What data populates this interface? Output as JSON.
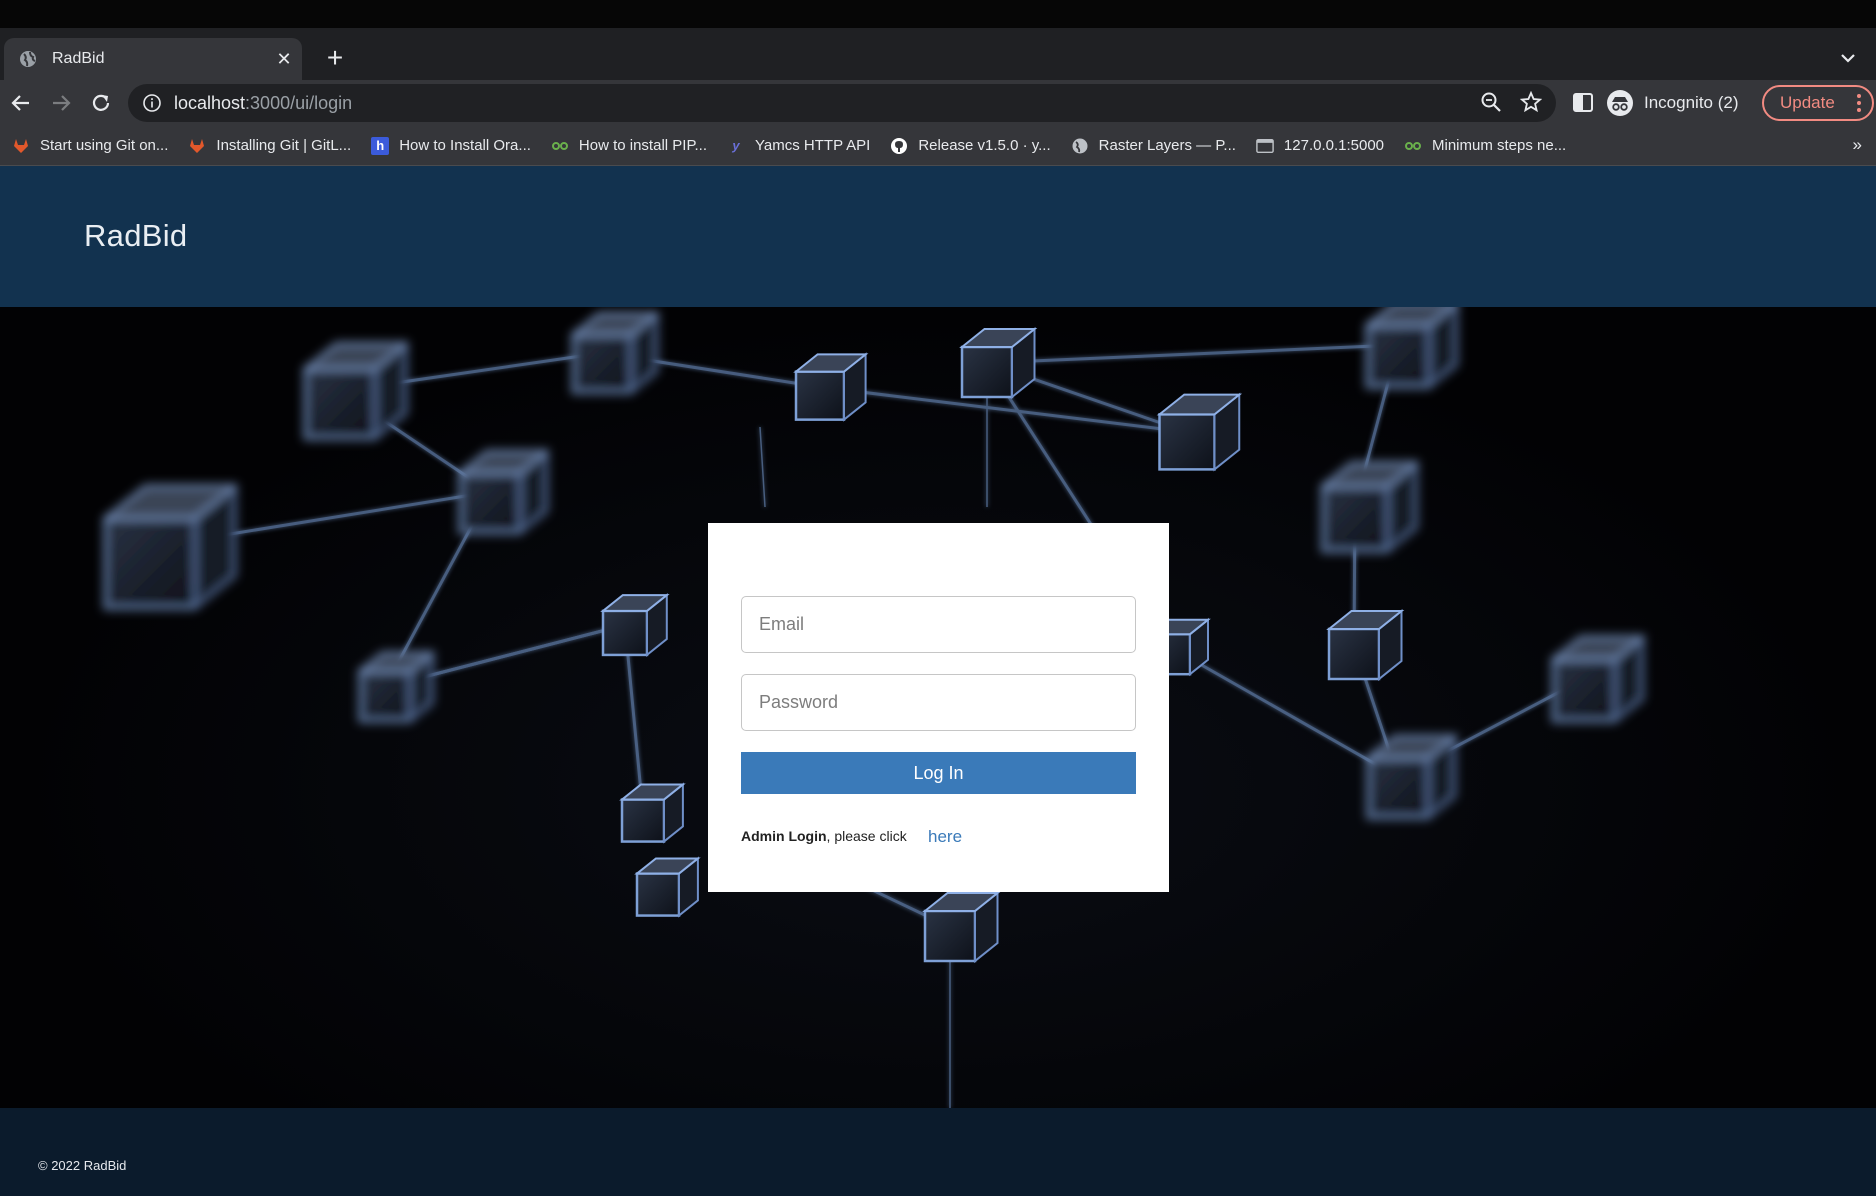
{
  "browser": {
    "tab": {
      "title": "RadBid",
      "favicon": "globe-icon"
    },
    "url": {
      "host": "localhost",
      "path": ":3000/ui/login"
    },
    "profile_label": "Incognito (2)",
    "update_label": "Update",
    "bookmarks": [
      {
        "label": "Start using Git on...",
        "icon": "gitlab-icon",
        "color": "#e2582b"
      },
      {
        "label": "Installing Git | GitL...",
        "icon": "gitlab-icon",
        "color": "#e2582b"
      },
      {
        "label": "How to Install Ora...",
        "icon": "h-icon",
        "color": "#3b5bdb"
      },
      {
        "label": "How to install PIP...",
        "icon": "link-icon",
        "color": "#6ab04c"
      },
      {
        "label": "Yamcs HTTP API",
        "icon": "yamcs-icon",
        "color": "#6a6fd8"
      },
      {
        "label": "Release v1.5.0 · y...",
        "icon": "github-icon",
        "color": "#ffffff"
      },
      {
        "label": "Raster Layers — P...",
        "icon": "globe-icon",
        "color": "#bdc1c6"
      },
      {
        "label": "127.0.0.1:5000",
        "icon": "page-icon",
        "color": "#bdc1c6"
      },
      {
        "label": "Minimum steps ne...",
        "icon": "link-icon",
        "color": "#6ab04c"
      }
    ],
    "bookmarks_more": "»"
  },
  "app": {
    "brand": "RadBid",
    "login": {
      "email_placeholder": "Email",
      "password_placeholder": "Password",
      "submit_label": "Log In",
      "admin_bold": "Admin Login",
      "admin_rest": ", please click",
      "admin_link": "here"
    },
    "footer": "© 2022 RadBid"
  },
  "colors": {
    "header_bg": "#12324f",
    "footer_bg": "#0b1b2c",
    "accent": "#3a7ab9"
  }
}
